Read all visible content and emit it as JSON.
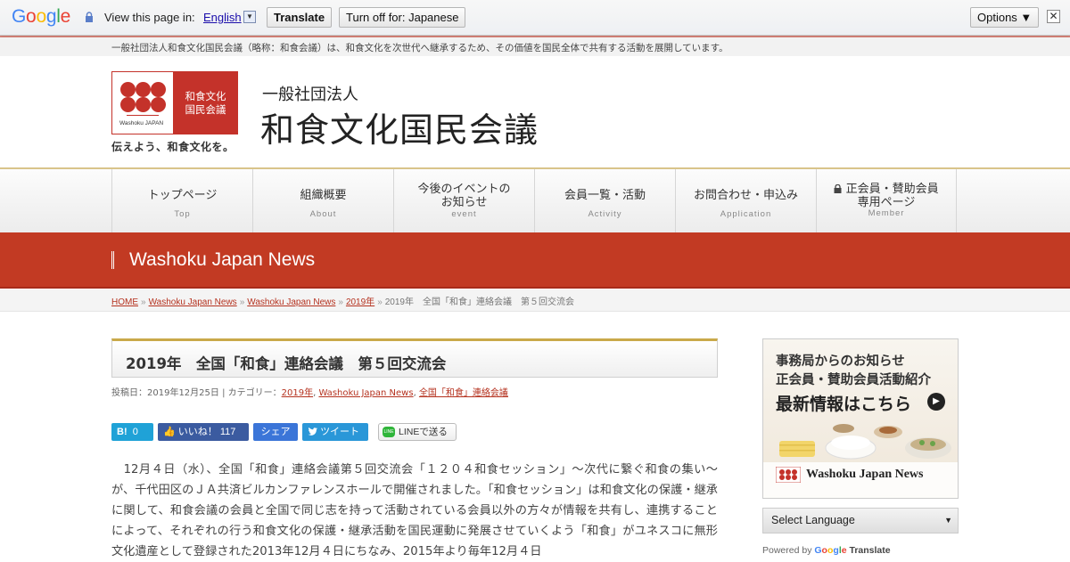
{
  "translate_bar": {
    "view_label": "View this page in:",
    "language": "English",
    "translate_button": "Translate",
    "turn_off_button": "Turn off for: Japanese",
    "options_button": "Options ▼",
    "close_label": "✕"
  },
  "site": {
    "tagline": "一般社団法人和食文化国民会議（略称：和食会議）は、和食文化を次世代へ継承するため、その価値を国民全体で共有する活動を展開しています。",
    "logo_text_line1": "和食文化",
    "logo_text_line2": "国民会議",
    "logo_en": "Washoku JAPAN",
    "slogan": "伝えよう、和食文化を。",
    "org_sub": "一般社団法人",
    "org_name": "和食文化国民会議"
  },
  "nav": [
    {
      "jp": "トップページ",
      "en": "Top"
    },
    {
      "jp": "組織概要",
      "en": "About"
    },
    {
      "jp": "今後のイベントの",
      "jp2": "お知らせ",
      "en": "event"
    },
    {
      "jp": "会員一覧・活動",
      "en": "Activity"
    },
    {
      "jp": "お問合わせ・申込み",
      "en": "Application"
    },
    {
      "jp": "正会員・賛助会員",
      "jp2": "専用ページ",
      "en": "Member"
    }
  ],
  "banner": {
    "title": "Washoku Japan News"
  },
  "breadcrumb": {
    "home": "HOME",
    "c1": "Washoku Japan News",
    "c2": "Washoku Japan News",
    "c3": "2019年",
    "current": "2019年　全国「和食」連絡会議　第５回交流会",
    "sep": "»"
  },
  "article": {
    "title": "2019年　全国「和食」連絡会議　第５回交流会",
    "meta_prefix": "投稿日：2019年12月25日 | カテゴリー：",
    "cat1": "2019年",
    "cat2": "Washoku Japan News",
    "cat3": "全国「和食」連絡会議",
    "body": "　12月４日（水）、全国「和食」連絡会議第５回交流会「１２０４和食セッション」～次代に繋ぐ和食の集い～が、千代田区のＪＡ共済ビルカンファレンスホールで開催されました。「和食セッション」は和食文化の保護・継承に関して、和食会議の会員と全国で同じ志を持って活動されている会員以外の方々が情報を共有し、連携することによって、それぞれの行う和食文化の保護・継承活動を国民運動に発展させていくよう「和食」がユネスコに無形文化遺産として登録された2013年12月４日にちなみ、2015年より毎年12月４日"
  },
  "share": {
    "hatena_label": "B!",
    "hatena_count": "0",
    "fb_label": "いいね！",
    "fb_count": "117",
    "share_label": "シェア",
    "tweet_label": "ツイート",
    "line_label": "LINEで送る",
    "line_icon_text": "LINE"
  },
  "sidebar": {
    "ad_line1": "事務局からのお知らせ",
    "ad_line2": "正会員・賛助会員活動紹介",
    "ad_line3": "最新情報はこちら",
    "ad_brand": "Washoku Japan News",
    "language_select": "Select Language",
    "powered_prefix": "Powered by",
    "powered_google": "Google",
    "powered_translate": "Translate"
  },
  "colors": {
    "brand_red": "#c23a23",
    "link_red": "#b5321f",
    "accent_gold": "#c9a94a"
  }
}
